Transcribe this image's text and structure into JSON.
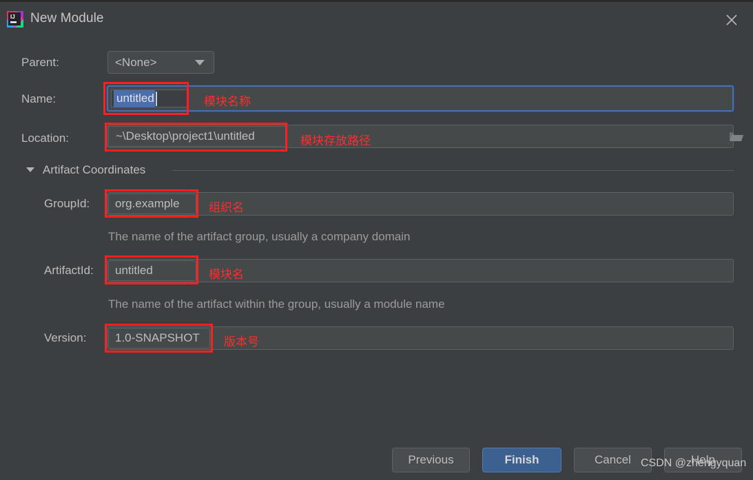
{
  "window": {
    "title": "New Module",
    "app_icon": "intellij-idea-icon",
    "close_icon": "close-icon"
  },
  "form": {
    "parent": {
      "label": "Parent:",
      "value": "<None>",
      "caret_icon": "chevron-down-icon"
    },
    "name": {
      "label": "Name:",
      "value": "untitled",
      "annotation": "模块名称"
    },
    "location": {
      "label": "Location:",
      "value": "~\\Desktop\\project1\\untitled",
      "annotation": "模块存放路径",
      "browse_icon": "folder-open-icon"
    },
    "section": {
      "label": "Artifact Coordinates",
      "arrow_icon": "triangle-down-icon"
    },
    "group_id": {
      "label": "GroupId:",
      "value": "org.example",
      "annotation": "组织名",
      "hint": "The name of the artifact group, usually a company domain"
    },
    "artifact_id": {
      "label": "ArtifactId:",
      "value": "untitled",
      "annotation": "模块名",
      "hint": "The name of the artifact within the group, usually a module name"
    },
    "version": {
      "label": "Version:",
      "value": "1.0-SNAPSHOT",
      "annotation": "版本号"
    }
  },
  "buttons": {
    "previous": "Previous",
    "finish": "Finish",
    "cancel": "Cancel",
    "help": "Help"
  },
  "watermark": "CSDN @zhengyquan",
  "colors": {
    "dialog_bg": "#3c3f41",
    "field_bg": "#45494a",
    "accent_blue": "#4b6eaf",
    "primary_button": "#3c6090",
    "annotation_red": "#ff2d2d",
    "highlight_box_red": "#ff1f1f",
    "text": "#bdbdbd",
    "hint_text": "#9b9b9b"
  }
}
